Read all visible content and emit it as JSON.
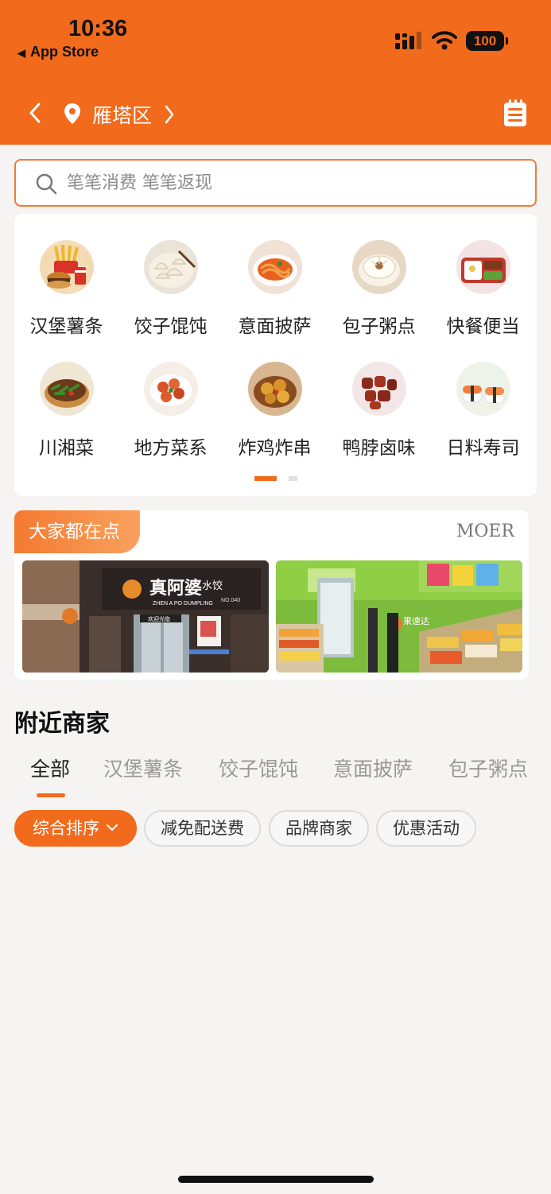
{
  "status_bar": {
    "time": "10:36",
    "back_app": "App Store",
    "battery": "100"
  },
  "nav": {
    "location": "雁塔区"
  },
  "search": {
    "placeholder": "笔笔消费 笔笔返现"
  },
  "categories": [
    {
      "label": "汉堡薯条",
      "icon": "burger-fries-icon"
    },
    {
      "label": "饺子馄饨",
      "icon": "dumplings-icon"
    },
    {
      "label": "意面披萨",
      "icon": "pasta-icon"
    },
    {
      "label": "包子粥点",
      "icon": "bun-icon"
    },
    {
      "label": "快餐便当",
      "icon": "bento-icon"
    },
    {
      "label": "川湘菜",
      "icon": "sichuan-dish-icon"
    },
    {
      "label": "地方菜系",
      "icon": "shrimp-dish-icon"
    },
    {
      "label": "炸鸡炸串",
      "icon": "fried-chicken-icon"
    },
    {
      "label": "鸭脖卤味",
      "icon": "braised-duck-icon"
    },
    {
      "label": "日料寿司",
      "icon": "sushi-icon"
    }
  ],
  "pagination": {
    "pages": 2,
    "active": 1
  },
  "popular": {
    "tag": "大家都在点",
    "more": "MOER",
    "images": [
      {
        "name": "dumpling-store-photo",
        "sign_main": "真阿婆",
        "sign_sub": "水饺",
        "sign_en": "ZHEN A PO DUMPLING",
        "sign_no": "NO.040",
        "door_text": "欢迎光临"
      },
      {
        "name": "fruit-store-photo",
        "sign_main": "果速达"
      }
    ]
  },
  "nearby": {
    "title": "附近商家",
    "tabs": [
      "全部",
      "汉堡薯条",
      "饺子馄饨",
      "意面披萨",
      "包子粥点"
    ],
    "active_tab": 0,
    "filters": [
      "综合排序",
      "减免配送费",
      "品牌商家",
      "优惠活动"
    ],
    "active_filter": 0
  },
  "colors": {
    "accent": "#f26a1b",
    "background": "#f5f4f3"
  }
}
